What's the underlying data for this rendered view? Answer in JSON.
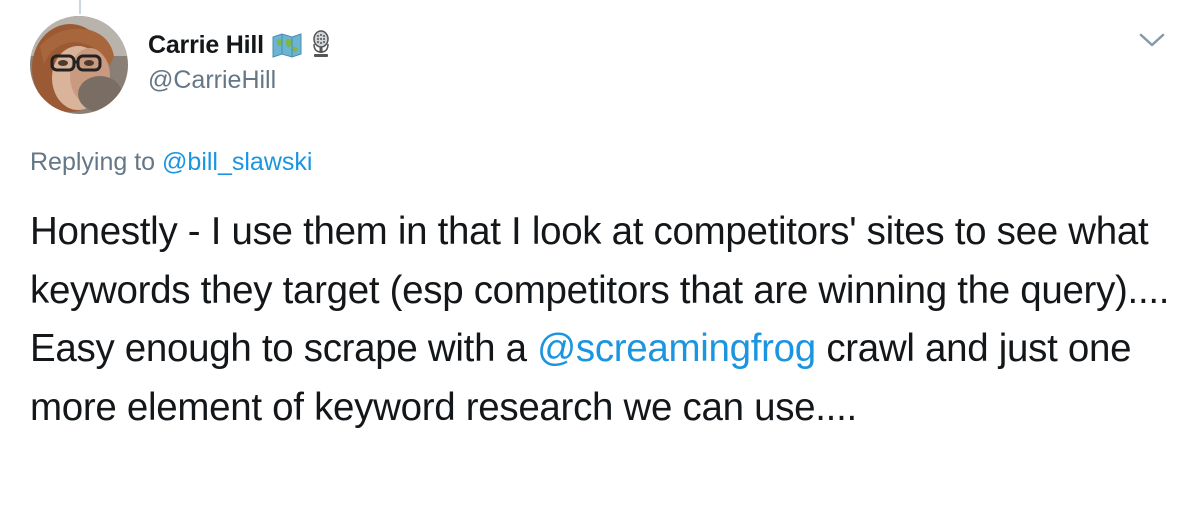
{
  "user": {
    "display_name": "Carrie Hill",
    "handle": "@CarrieHill",
    "name_emojis": [
      "world-map-icon",
      "microphone-icon"
    ]
  },
  "reply": {
    "prefix": "Replying to",
    "mention": "@bill_slawski"
  },
  "tweet": {
    "text_1": "Honestly - I use them in that I look at competitors' sites to see what keywords they target (esp competitors that are winning the query).... Easy enough to scrape with a",
    "mention": "@screamingfrog",
    "text_2": " crawl and just one more element of keyword research we can use...."
  },
  "colors": {
    "link": "#1b95e0",
    "secondary": "#657786",
    "text": "#14171a"
  }
}
